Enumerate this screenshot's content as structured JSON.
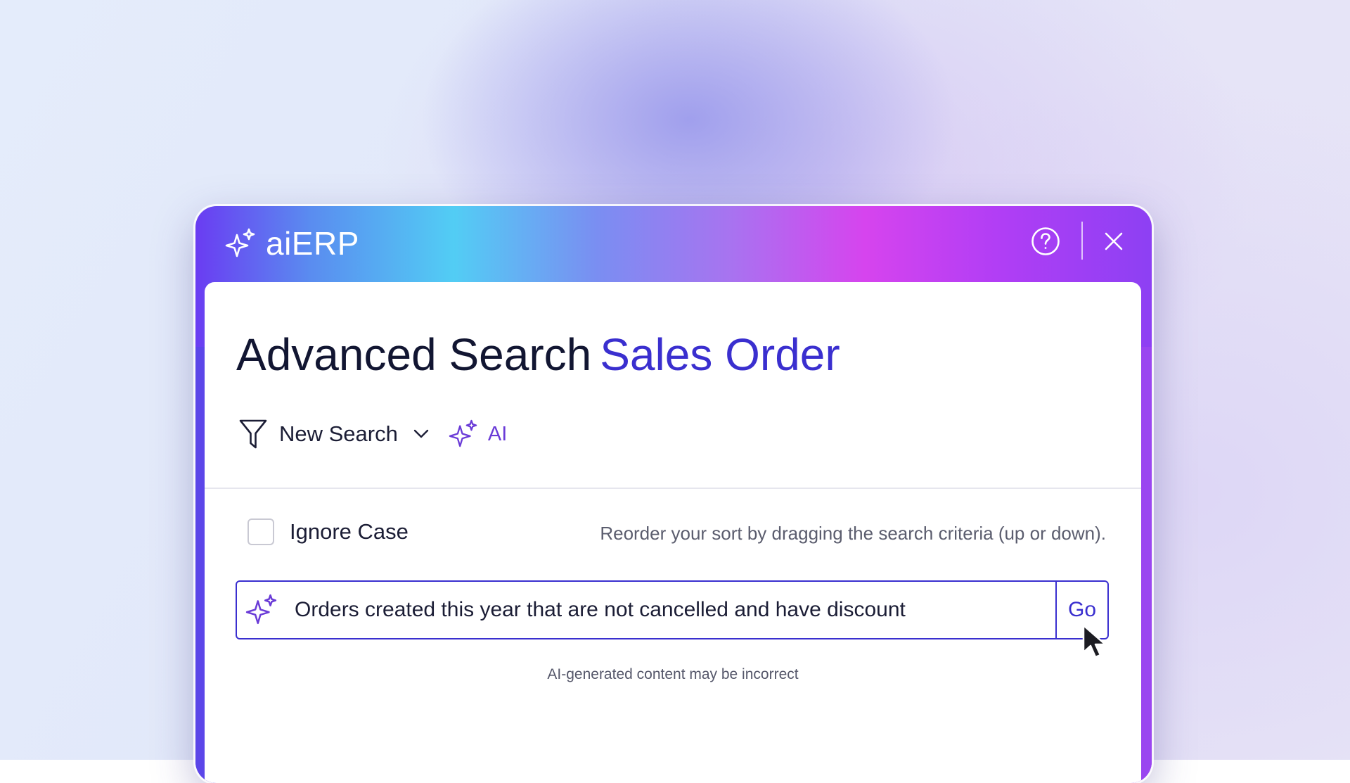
{
  "app": {
    "name": "aiERP",
    "help_icon": "help-circle-icon",
    "close_icon": "close-icon"
  },
  "page": {
    "title": "Advanced Search",
    "entity": "Sales Order"
  },
  "toolbar": {
    "filter_icon": "filter-icon",
    "search_selector_label": "New Search",
    "ai_label": "AI"
  },
  "options": {
    "ignore_case_label": "Ignore Case",
    "ignore_case_checked": false,
    "hint": "Reorder your sort by dragging the search criteria (up or down)."
  },
  "ai_search": {
    "query": "Orders created this year that are not cancelled and have discount",
    "go_label": "Go",
    "disclaimer": "AI-generated content may be incorrect"
  },
  "colors": {
    "accent": "#3a2fcf",
    "ai_purple": "#6a3bd7",
    "heading_text": "#121632"
  }
}
